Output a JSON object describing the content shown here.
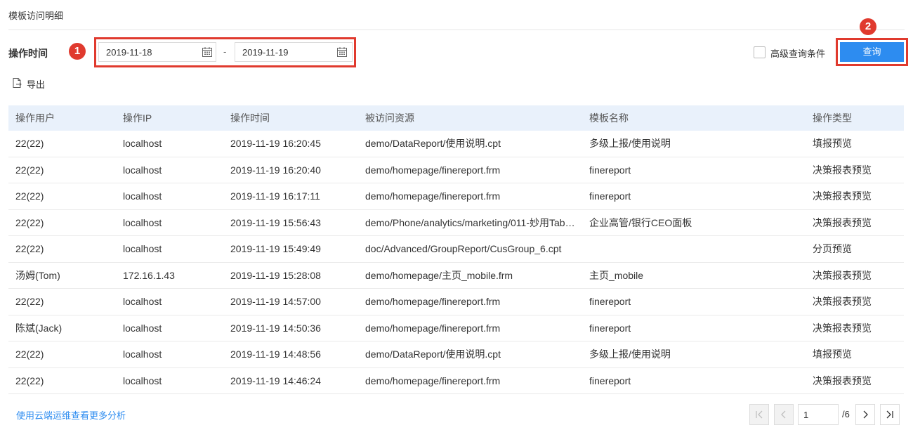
{
  "page": {
    "title": "模板访问明细"
  },
  "filter": {
    "label": "操作时间",
    "start_date": "2019-11-18",
    "separator": "-",
    "end_date": "2019-11-19",
    "advanced_label": "高级查询条件",
    "query_label": "查询"
  },
  "markers": {
    "one": "1",
    "two": "2"
  },
  "toolbar": {
    "export_label": "导出"
  },
  "table": {
    "headers": [
      "操作用户",
      "操作IP",
      "操作时间",
      "被访问资源",
      "模板名称",
      "操作类型"
    ],
    "rows": [
      [
        "22(22)",
        "localhost",
        "2019-11-19 16:20:45",
        "demo/DataReport/使用说明.cpt",
        "多级上报/使用说明",
        "填报预览"
      ],
      [
        "22(22)",
        "localhost",
        "2019-11-19 16:20:40",
        "demo/homepage/finereport.frm",
        "finereport",
        "决策报表预览"
      ],
      [
        "22(22)",
        "localhost",
        "2019-11-19 16:17:11",
        "demo/homepage/finereport.frm",
        "finereport",
        "决策报表预览"
      ],
      [
        "22(22)",
        "localhost",
        "2019-11-19 15:56:43",
        "demo/Phone/analytics/marketing/011-妙用Tab顶...",
        "企业高管/银行CEO面板",
        "决策报表预览"
      ],
      [
        "22(22)",
        "localhost",
        "2019-11-19 15:49:49",
        "doc/Advanced/GroupReport/CusGroup_6.cpt",
        "",
        "分页预览"
      ],
      [
        "汤姆(Tom)",
        "172.16.1.43",
        "2019-11-19 15:28:08",
        "demo/homepage/主页_mobile.frm",
        "主页_mobile",
        "决策报表预览"
      ],
      [
        "22(22)",
        "localhost",
        "2019-11-19 14:57:00",
        "demo/homepage/finereport.frm",
        "finereport",
        "决策报表预览"
      ],
      [
        "陈斌(Jack)",
        "localhost",
        "2019-11-19 14:50:36",
        "demo/homepage/finereport.frm",
        "finereport",
        "决策报表预览"
      ],
      [
        "22(22)",
        "localhost",
        "2019-11-19 14:48:56",
        "demo/DataReport/使用说明.cpt",
        "多级上报/使用说明",
        "填报预览"
      ],
      [
        "22(22)",
        "localhost",
        "2019-11-19 14:46:24",
        "demo/homepage/finereport.frm",
        "finereport",
        "决策报表预览"
      ]
    ]
  },
  "footer": {
    "more_link": "使用云端运维查看更多分析"
  },
  "pagination": {
    "current": "1",
    "total": "/6"
  },
  "colors": {
    "accent": "#2d8cf0",
    "highlight": "#e03a2e",
    "header_bg": "#e9f1fb"
  },
  "icons": {
    "calendar": "calendar-icon",
    "export": "export-icon",
    "first": "first-page-icon",
    "prev": "prev-page-icon",
    "next": "next-page-icon",
    "last": "last-page-icon"
  }
}
